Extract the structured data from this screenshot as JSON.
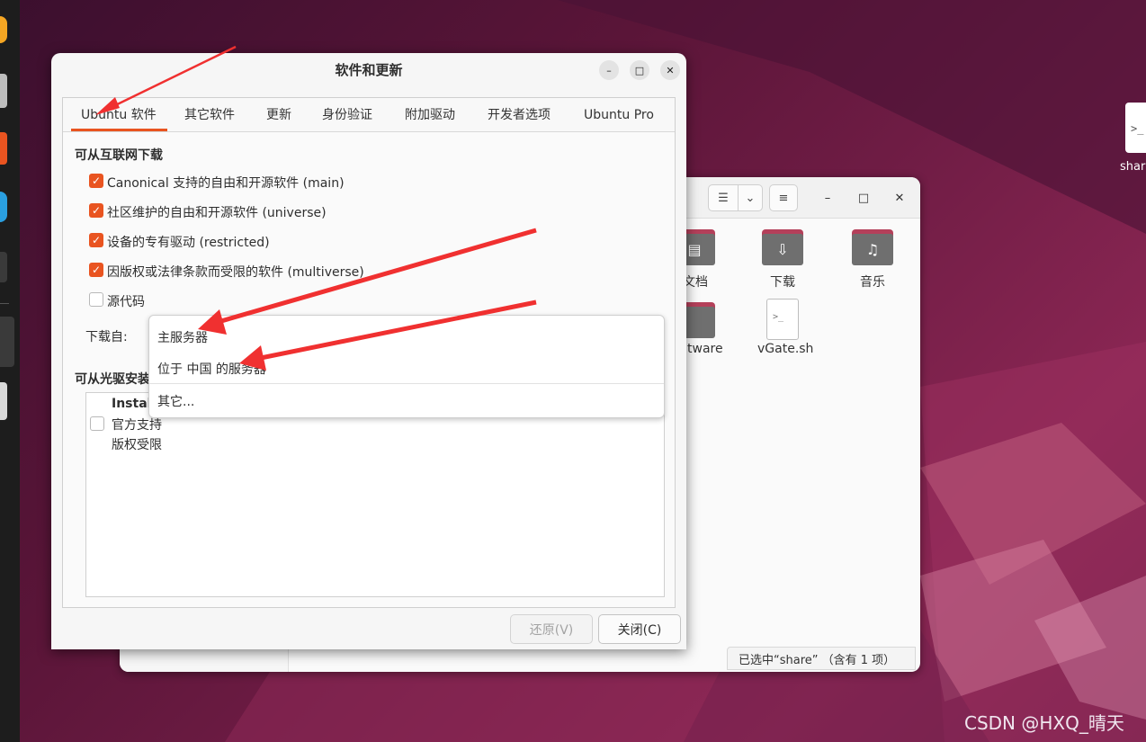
{
  "dialog": {
    "title": "软件和更新",
    "tabs": [
      "Ubuntu 软件",
      "其它软件",
      "更新",
      "身份验证",
      "附加驱动",
      "开发者选项",
      "Ubuntu Pro"
    ],
    "internet_section": "可从互联网下载",
    "sources": [
      {
        "label": "Canonical 支持的自由和开源软件 (main)",
        "checked": true
      },
      {
        "label": "社区维护的自由和开源软件 (universe)",
        "checked": true
      },
      {
        "label": "设备的专有驱动 (restricted)",
        "checked": true
      },
      {
        "label": "因版权或法律条款而受限的软件 (multiverse)",
        "checked": true
      },
      {
        "label": "源代码",
        "checked": false
      }
    ],
    "download_from_label": "下载自:",
    "download_options": [
      "主服务器",
      "位于 中国 的服务器",
      "其它..."
    ],
    "cdrom_section": "可从光驱安装",
    "cdrom_item": {
      "line1": "Install",
      "line2": "官方支持",
      "line3": "版权受限"
    },
    "revert_button": "还原(V)",
    "close_button": "关闭(C)"
  },
  "file_manager": {
    "items": [
      "文档",
      "下载",
      "音乐",
      "tware",
      "vGate.sh"
    ],
    "status": "已选中“share” （含有 1 项）"
  },
  "desktop": {
    "icon_label": "shar"
  },
  "watermark": "CSDN @HXQ_晴天",
  "colors": {
    "accent": "#e95420",
    "arrow": "#f03030",
    "folder_tab": "#b4405a"
  }
}
